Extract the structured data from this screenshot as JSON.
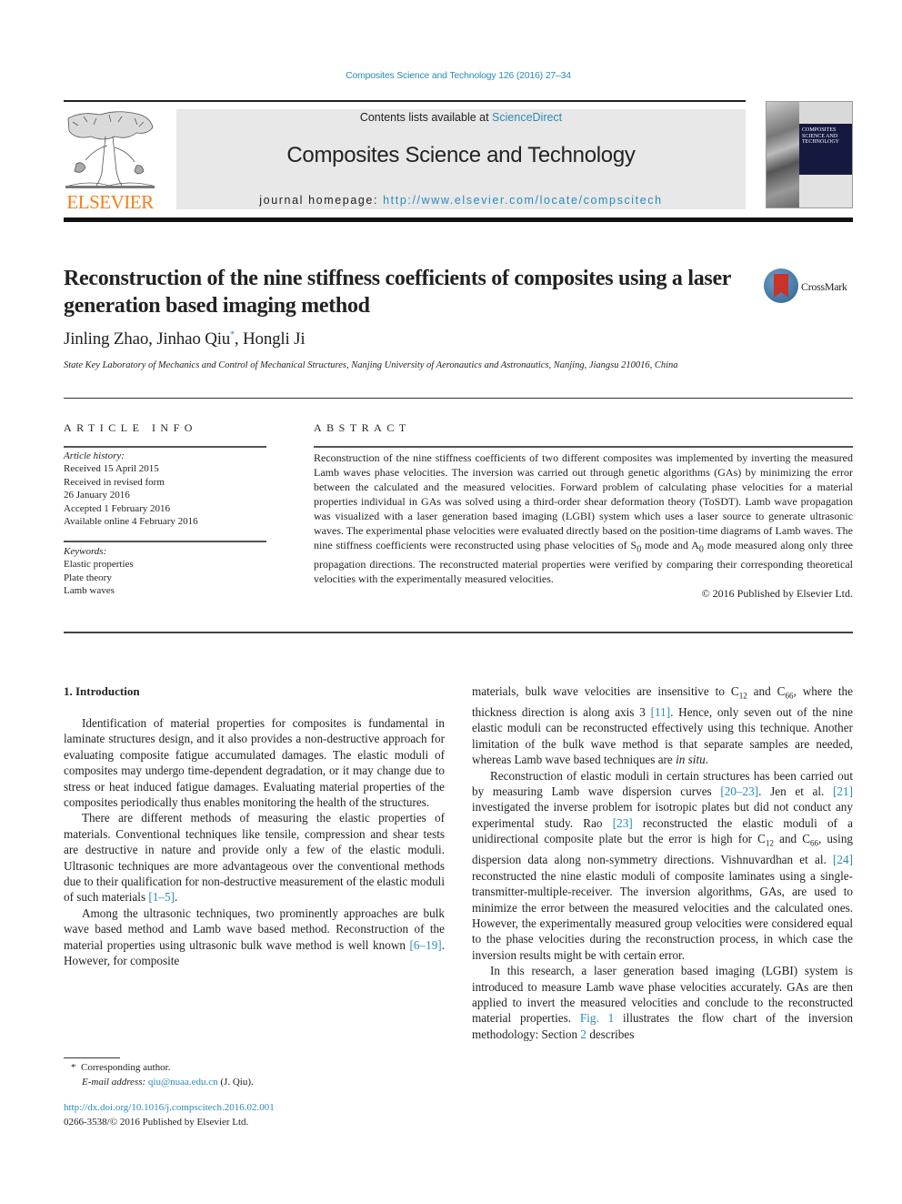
{
  "journal_reference": "Composites Science and Technology 126 (2016) 27–34",
  "header": {
    "publisher_wordmark": "ELSEVIER",
    "contents_prefix": "Contents lists available at ",
    "contents_link": "ScienceDirect",
    "journal_name": "Composites Science and Technology",
    "homepage_prefix": "journal homepage: ",
    "homepage_url": "http://www.elsevier.com/locate/compscitech",
    "cover_title_lines": [
      "COMPOSITES",
      "SCIENCE AND",
      "TECHNOLOGY"
    ]
  },
  "article": {
    "title": "Reconstruction of the nine stiffness coefficients of composites using a laser generation based imaging method",
    "crossmark_label": "CrossMark",
    "authors": [
      {
        "name": "Jinling Zhao",
        "sep": ", "
      },
      {
        "name": "Jinhao Qiu",
        "mark": "*",
        "sep": ", "
      },
      {
        "name": "Hongli Ji",
        "sep": ""
      }
    ],
    "affiliation": "State Key Laboratory of Mechanics and Control of Mechanical Structures, Nanjing University of Aeronautics and Astronautics, Nanjing, Jiangsu 210016, China"
  },
  "article_info": {
    "label": "ARTICLE INFO",
    "history_heading": "Article history:",
    "history": [
      "Received 15 April 2015",
      "Received in revised form",
      "26 January 2016",
      "Accepted 1 February 2016",
      "Available online 4 February 2016"
    ],
    "keywords_heading": "Keywords:",
    "keywords": [
      "Elastic properties",
      "Plate theory",
      "Lamb waves"
    ]
  },
  "abstract": {
    "label": "ABSTRACT",
    "text_part1": "Reconstruction of the nine stiffness coefficients of two different composites was implemented by inverting the measured Lamb waves phase velocities. The inversion was carried out through genetic algorithms (GAs) by minimizing the error between the calculated and the measured velocities. Forward problem of calculating phase velocities for a material properties individual in GAs was solved using a third-order shear deformation theory (ToSDT). Lamb wave propagation was visualized with a laser generation based imaging (LGBI) system which uses a laser source to generate ultrasonic waves. The experimental phase velocities were evaluated directly based on the position-time diagrams of Lamb waves. The nine stiffness coefficients were reconstructed using phase velocities of S",
    "sub1": "0",
    "text_part2": " mode and A",
    "sub2": "0",
    "text_part3": " mode measured along only three propagation directions. The reconstructed material properties were verified by comparing their corresponding theoretical velocities with the experimentally measured velocities.",
    "copyright": "© 2016 Published by Elsevier Ltd."
  },
  "body": {
    "section_heading": "1.  Introduction",
    "left": {
      "p1": "Identification of material properties for composites is fundamental in laminate structures design, and it also provides a non-destructive approach for evaluating composite fatigue accumulated damages. The elastic moduli of composites may undergo time-dependent degradation, or it may change due to stress or heat induced fatigue damages. Evaluating material properties of the composites periodically thus enables monitoring the health of the structures.",
      "p2_text": "There are different methods of measuring the elastic properties of materials. Conventional techniques like tensile, compression and shear tests are destructive in nature and provide only a few of the elastic moduli. Ultrasonic techniques are more advantageous over the conventional methods due to their qualification for non-destructive measurement of the elastic moduli of such materials ",
      "p2_ref": "[1–5]",
      "p2_end": ".",
      "p3_text": "Among the ultrasonic techniques, two prominently approaches are bulk wave based method and Lamb wave based method. Reconstruction of the material properties using ultrasonic bulk wave method is well known ",
      "p3_ref": "[6–19]",
      "p3_end": ". However, for composite"
    },
    "right": {
      "p1_a": "materials, bulk wave velocities are insensitive to C",
      "p1_sub1": "12",
      "p1_b": " and C",
      "p1_sub2": "66",
      "p1_c": ", where the thickness direction is along axis 3 ",
      "p1_ref": "[11]",
      "p1_d": ". Hence, only seven out of the nine elastic moduli can be reconstructed effectively using this technique. Another limitation of the bulk wave method is that separate samples are needed, whereas Lamb wave based techniques are ",
      "p1_em": "in situ",
      "p1_e": ".",
      "p2_a": "Reconstruction of elastic moduli in certain structures has been carried out by measuring Lamb wave dispersion curves ",
      "p2_ref1": "[20–23]",
      "p2_b": ". Jen et al. ",
      "p2_ref2": "[21]",
      "p2_c": " investigated the inverse problem for isotropic plates but did not conduct any experimental study. Rao ",
      "p2_ref3": "[23]",
      "p2_d": " reconstructed the elastic moduli of a unidirectional composite plate but the error is high for C",
      "p2_sub1": "12",
      "p2_e": " and C",
      "p2_sub2": "66",
      "p2_f": ", using dispersion data along non-symmetry directions. Vishnuvardhan et al. ",
      "p2_ref4": "[24]",
      "p2_g": " reconstructed the nine elastic moduli of composite laminates using a single-transmitter-multiple-receiver. The inversion algorithms, GAs, are used to minimize the error between the measured velocities and the calculated ones. However, the experimentally measured group velocities were considered equal to the phase velocities during the reconstruction process, in which case the inversion results might be with certain error.",
      "p3_a": "In this research, a laser generation based imaging (LGBI) system is introduced to measure Lamb wave phase velocities accurately. GAs are then applied to invert the measured velocities and conclude to the reconstructed material properties. ",
      "p3_ref1": "Fig. 1",
      "p3_b": " illustrates the flow chart of the inversion methodology: Section ",
      "p3_ref2": "2",
      "p3_c": " describes"
    }
  },
  "footnote": {
    "mark": "*",
    "corresponding": "Corresponding author.",
    "email_label": "E-mail address:",
    "email": "qiu@nuaa.edu.cn",
    "email_owner": " (J. Qiu)."
  },
  "doi": "http://dx.doi.org/10.1016/j.compscitech.2016.02.001",
  "issn_line": "0266-3538/© 2016 Published by Elsevier Ltd.",
  "colors": {
    "link": "#2a8bb8",
    "elsevier_orange": "#f07f1c",
    "header_gray": "#e8e8e8",
    "cover_navy": "#16193f"
  }
}
